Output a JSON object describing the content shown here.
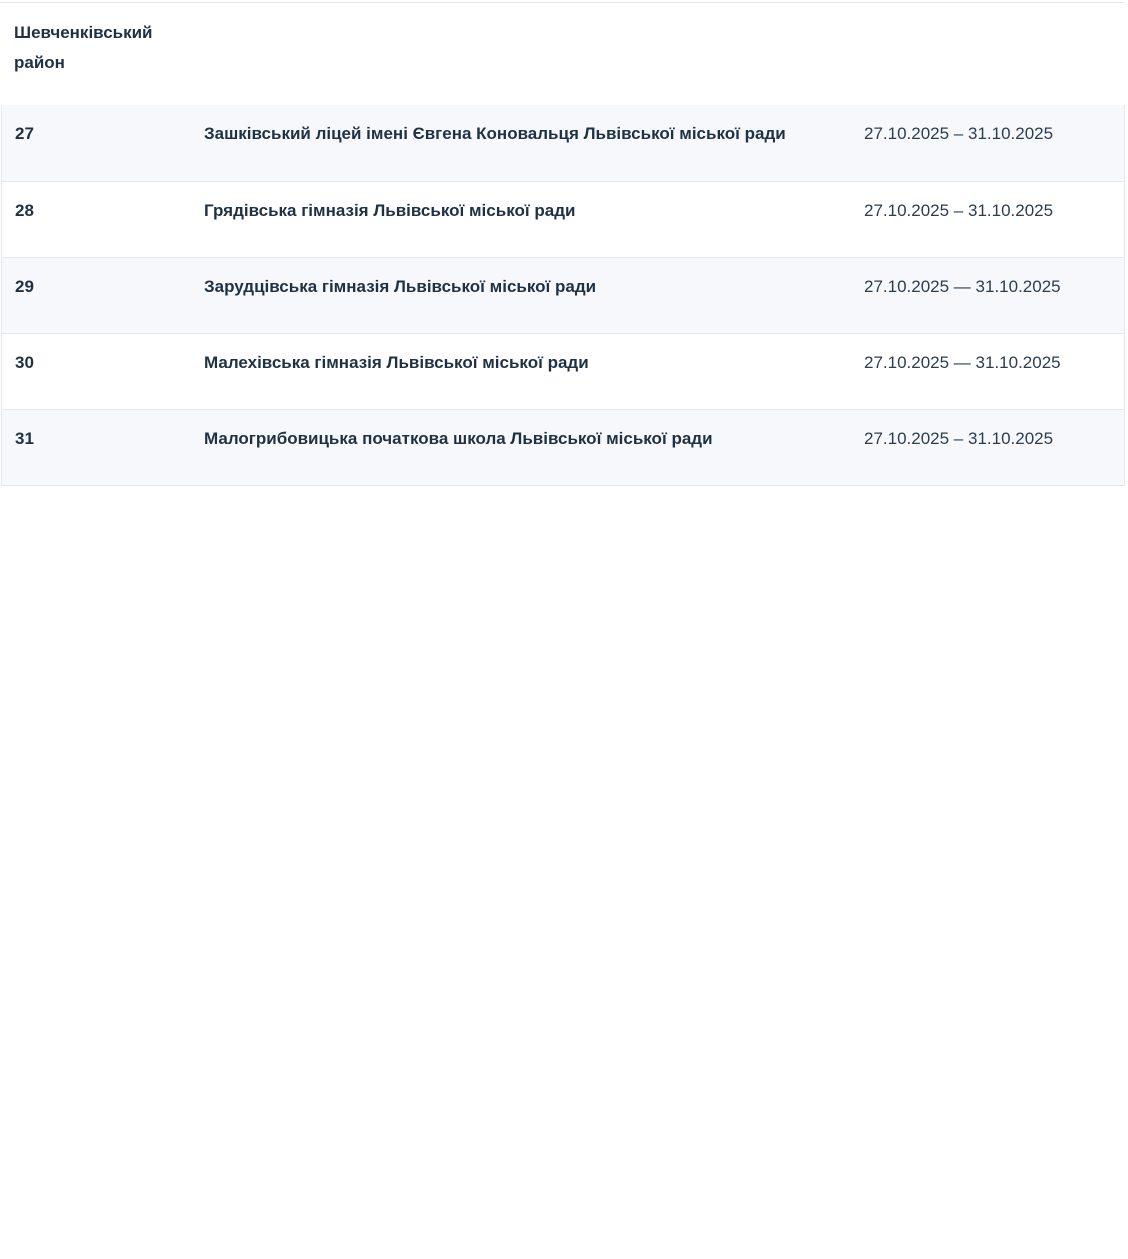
{
  "district": {
    "title_line1": "Шевченківський",
    "title_line2": "район"
  },
  "rows": [
    {
      "num": "27",
      "name": "Зашківський ліцей імені Євгена Коновальця Львівської міської ради",
      "dates": "27.10.2025 – 31.10.2025"
    },
    {
      "num": "28",
      "name": "Грядівська гімназія Львівської міської ради",
      "dates": "27.10.2025 – 31.10.2025"
    },
    {
      "num": "29",
      "name": "Зарудцівська гімназія Львівської міської ради",
      "dates": "27.10.2025 — 31.10.2025"
    },
    {
      "num": "30",
      "name": "Малехівська гімназія Львівської міської ради",
      "dates": "27.10.2025 — 31.10.2025"
    },
    {
      "num": "31",
      "name": "Малогрибовицька початкова школа Львівської міської ради",
      "dates": "27.10.2025 – 31.10.2025"
    }
  ]
}
